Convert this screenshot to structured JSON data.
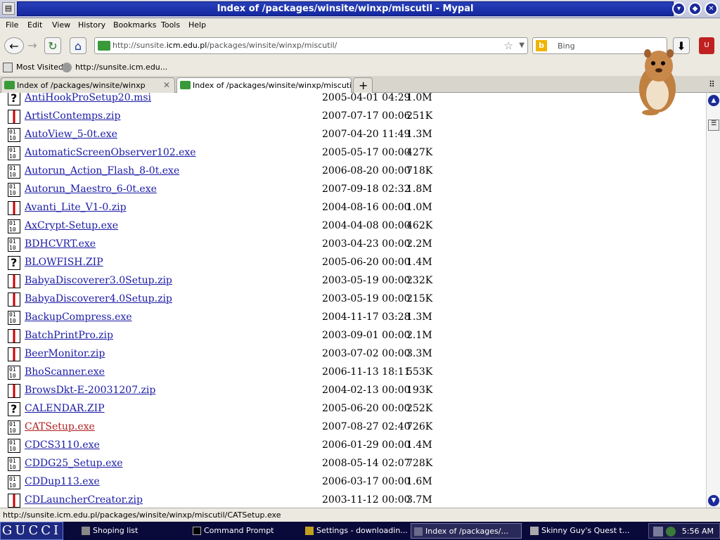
{
  "window": {
    "title": "Index of /packages/winsite/winxp/miscutil - Mypal"
  },
  "menu": [
    "File",
    "Edit",
    "View",
    "History",
    "Bookmarks",
    "Tools",
    "Help"
  ],
  "nav": {
    "url_prefix": "http://sunsite.",
    "url_host": "icm.edu.pl",
    "url_path": "/packages/winsite/winxp/miscutil/",
    "search_placeholder": "Bing",
    "search_engine_icon": "b"
  },
  "bookmarks": [
    "Most Visited",
    "http://sunsite.icm.edu..."
  ],
  "tabs": [
    {
      "label": "Index of /packages/winsite/winxp"
    },
    {
      "label": "Index of /packages/winsite/winxp/miscutil"
    }
  ],
  "files": [
    {
      "name": "AntiHookProSetup20.msi",
      "date": "2005-04-01 04:29",
      "size": "1.0M",
      "type": "unknown"
    },
    {
      "name": "ArtistContemps.zip",
      "date": "2007-07-17 00:06",
      "size": "251K",
      "type": "zip"
    },
    {
      "name": "AutoView_5-0t.exe",
      "date": "2007-04-20 11:49",
      "size": "1.3M",
      "type": "binary"
    },
    {
      "name": "AutomaticScreenObserver102.exe",
      "date": "2005-05-17 00:00",
      "size": "427K",
      "type": "binary"
    },
    {
      "name": "Autorun_Action_Flash_8-0t.exe",
      "date": "2006-08-20 00:00",
      "size": "718K",
      "type": "binary"
    },
    {
      "name": "Autorun_Maestro_6-0t.exe",
      "date": "2007-09-18 02:32",
      "size": "1.8M",
      "type": "binary"
    },
    {
      "name": "Avanti_Lite_V1-0.zip",
      "date": "2004-08-16 00:00",
      "size": "1.0M",
      "type": "zip"
    },
    {
      "name": "AxCrypt-Setup.exe",
      "date": "2004-04-08 00:00",
      "size": "462K",
      "type": "binary"
    },
    {
      "name": "BDHCVRT.exe",
      "date": "2003-04-23 00:00",
      "size": "2.2M",
      "type": "binary"
    },
    {
      "name": "BLOWFISH.ZIP",
      "date": "2005-06-20 00:00",
      "size": "1.4M",
      "type": "unknown"
    },
    {
      "name": "BabyaDiscoverer3.0Setup.zip",
      "date": "2003-05-19 00:00",
      "size": "232K",
      "type": "zip"
    },
    {
      "name": "BabyaDiscoverer4.0Setup.zip",
      "date": "2003-05-19 00:00",
      "size": "215K",
      "type": "zip"
    },
    {
      "name": "BackupCompress.exe",
      "date": "2004-11-17 03:28",
      "size": "1.3M",
      "type": "binary"
    },
    {
      "name": "BatchPrintPro.zip",
      "date": "2003-09-01 00:00",
      "size": "2.1M",
      "type": "zip"
    },
    {
      "name": "BeerMonitor.zip",
      "date": "2003-07-02 00:00",
      "size": "3.3M",
      "type": "zip"
    },
    {
      "name": "BhoScanner.exe",
      "date": "2006-11-13 18:11",
      "size": "553K",
      "type": "binary"
    },
    {
      "name": "BrowsDkt-E-20031207.zip",
      "date": "2004-02-13 00:00",
      "size": "193K",
      "type": "zip"
    },
    {
      "name": "CALENDAR.ZIP",
      "date": "2005-06-20 00:00",
      "size": "252K",
      "type": "unknown"
    },
    {
      "name": "CATSetup.exe",
      "date": "2007-08-27 02:40",
      "size": "726K",
      "type": "binary",
      "visited": true
    },
    {
      "name": "CDCS3110.exe",
      "date": "2006-01-29 00:00",
      "size": "1.4M",
      "type": "binary"
    },
    {
      "name": "CDDG25_Setup.exe",
      "date": "2008-05-14 02:07",
      "size": "728K",
      "type": "binary"
    },
    {
      "name": "CDDup113.exe",
      "date": "2006-03-17 00:00",
      "size": "1.6M",
      "type": "binary"
    },
    {
      "name": "CDLauncherCreator.zip",
      "date": "2003-11-12 00:00",
      "size": "3.7M",
      "type": "zip"
    }
  ],
  "status": {
    "text": "http://sunsite.icm.edu.pl/packages/winsite/winxp/miscutil/CATSetup.exe"
  },
  "taskbar": {
    "start_label": "GUCCI",
    "tasks": [
      "Shoping list",
      "Command Prompt",
      "Settings - downloadin...",
      "Index of /packages/...",
      "Skinny Guy's Quest t..."
    ],
    "clock": "5:56 AM"
  }
}
